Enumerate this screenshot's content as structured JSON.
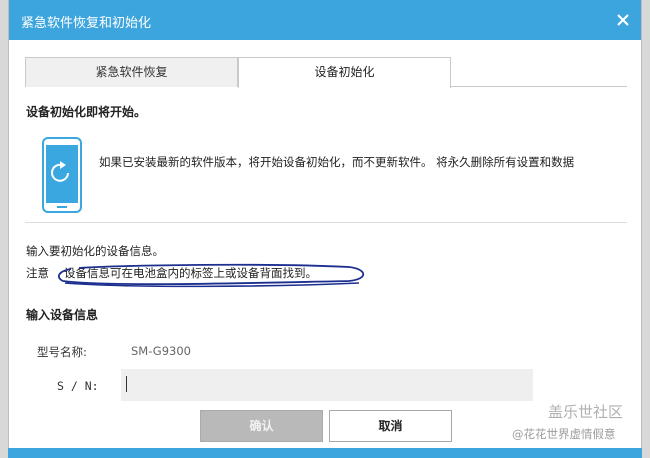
{
  "window": {
    "title": "紧急软件恢复和初始化",
    "close_icon": "close-icon"
  },
  "tabs": [
    {
      "label": "紧急软件恢复",
      "active": false
    },
    {
      "label": "设备初始化",
      "active": true
    }
  ],
  "main": {
    "heading": "设备初始化即将开始。",
    "icon": "phone-refresh-icon",
    "description": "如果已安装最新的软件版本，将开始设备初始化，而不更新软件。 将永久删除所有设置和数据",
    "info_text": "输入要初始化的设备信息。",
    "note_label": "注意",
    "note_text": "设备信息可在电池盒内的标签上或设备背面找到。"
  },
  "form": {
    "section_title": "输入设备信息",
    "model_label": "型号名称:",
    "model_value": "SM-G9300",
    "sn_label": "S / N:",
    "sn_value": ""
  },
  "buttons": {
    "ok": "确认",
    "cancel": "取消"
  },
  "watermark": {
    "line1": "盖乐世社区",
    "line2": "@花花世界虚情假意"
  },
  "colors": {
    "titlebar": "#3da5de",
    "ok_disabled": "#b9b9b9",
    "scribble": "#1c2f8f"
  }
}
